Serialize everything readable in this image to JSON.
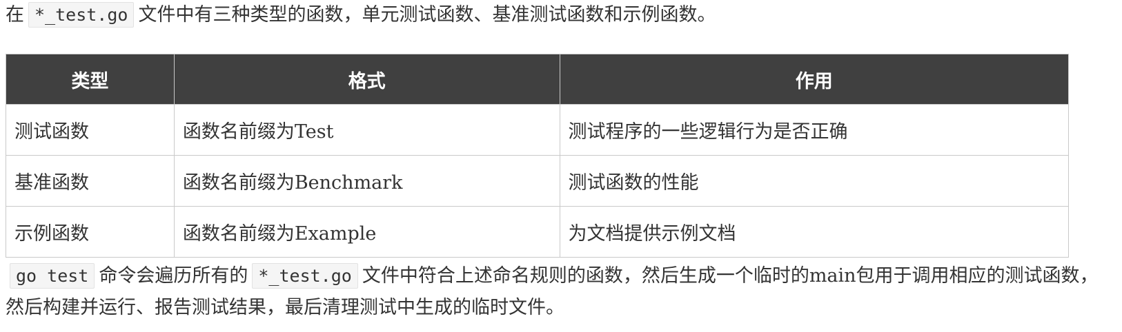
{
  "intro": {
    "prefix": "在",
    "code": "*_test.go",
    "suffix": "文件中有三种类型的函数，单元测试函数、基准测试函数和示例函数。"
  },
  "table": {
    "headers": [
      "类型",
      "格式",
      "作用"
    ],
    "rows": [
      [
        "测试函数",
        "函数名前缀为Test",
        "测试程序的一些逻辑行为是否正确"
      ],
      [
        "基准函数",
        "函数名前缀为Benchmark",
        "测试函数的性能"
      ],
      [
        "示例函数",
        "函数名前缀为Example",
        "为文档提供示例文档"
      ]
    ]
  },
  "outro": {
    "code1": "go test",
    "text1": "命令会遍历所有的",
    "code2": "*_test.go",
    "text2": "文件中符合上述命名规则的函数，然后生成一个临时的main包用于调用相应的测试函数，然后构建并运行、报告测试结果，最后清理测试中生成的临时文件。"
  },
  "colors": {
    "header_bg": "#404040",
    "header_text": "#ffffff",
    "border": "#c9c9c9",
    "code_bg": "#f5f5f5"
  }
}
